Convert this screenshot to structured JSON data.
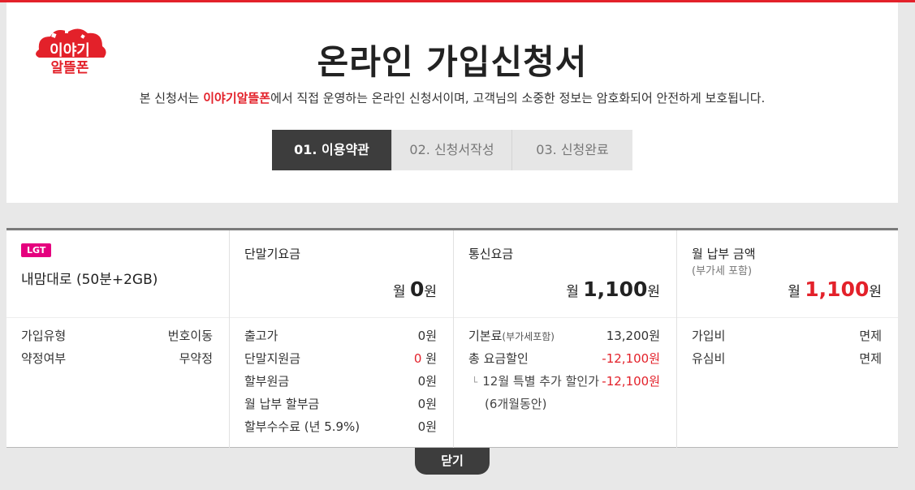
{
  "header": {
    "logo_text_top": "이야기",
    "logo_text_bottom": "알뜰폰",
    "title": "온라인 가입신청서",
    "subtitle_pre": "본 신청서는 ",
    "subtitle_brand": "이야기알뜰폰",
    "subtitle_post": "에서 직접 운영하는 온라인 신청서이며, 고객님의 소중한 정보는 암호화되어 안전하게 보호됩니다.",
    "steps": [
      {
        "label": "01. 이용약관",
        "active": true
      },
      {
        "label": "02. 신청서작성",
        "active": false
      },
      {
        "label": "03. 신청완료",
        "active": false
      }
    ]
  },
  "plan": {
    "carrier_badge": "LGT",
    "name": "내맘대로 (50분+2GB)",
    "rows": [
      {
        "label": "가입유형",
        "value": "번호이동"
      },
      {
        "label": "약정여부",
        "value": "무약정"
      }
    ]
  },
  "device": {
    "title": "단말기요금",
    "amount_prefix": "월 ",
    "amount": "0",
    "amount_suffix": "원",
    "rows": [
      {
        "label": "출고가",
        "value": "0원"
      },
      {
        "label": "단말지원금",
        "value_num": "0",
        "value_unit": " 원"
      },
      {
        "label": "할부원금",
        "value": "0원"
      },
      {
        "label": "월 납부 할부금",
        "value": "0원"
      },
      {
        "label": "할부수수료 (년 5.9%)",
        "value": "0원"
      }
    ]
  },
  "telecom": {
    "title": "통신요금",
    "amount_prefix": "월 ",
    "amount": "1,100",
    "amount_suffix": "원",
    "base_label": "기본료",
    "base_label_small": "(부가세포함)",
    "base_value": "13,200원",
    "discount_label": "총 요금할인",
    "discount_value": "-12,100원",
    "special_tree": "└",
    "special_label": "12월 특별 추가 할인가",
    "special_value": "-12,100원",
    "special_note": "(6개월동안)"
  },
  "monthly": {
    "title": "월 납부 금액",
    "subtitle": "(부가세 포함)",
    "amount_prefix": "월 ",
    "amount": "1,100",
    "amount_suffix": "원",
    "rows": [
      {
        "label": "가입비",
        "value": "면제"
      },
      {
        "label": "유심비",
        "value": "면제"
      }
    ]
  },
  "close_label": "닫기",
  "colors": {
    "accent": "#e3212a",
    "badge": "#e5007e",
    "dark": "#3d3d3d"
  }
}
